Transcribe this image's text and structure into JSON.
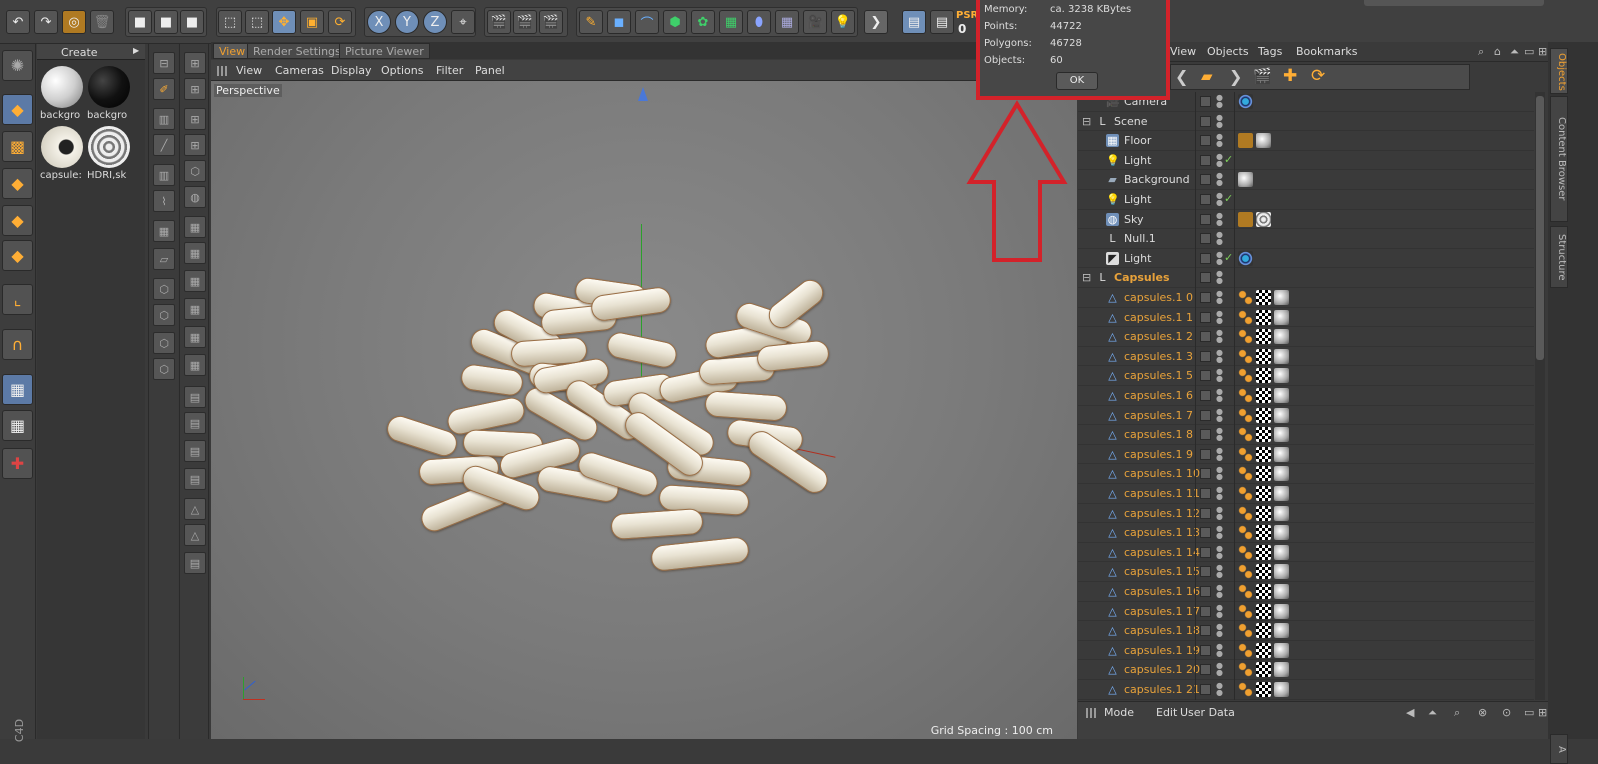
{
  "toolbar": {
    "axis_x": "X",
    "axis_y": "Y",
    "axis_z": "Z",
    "psr_label": "PSR",
    "psr_value": "0"
  },
  "materials": {
    "create_label": "Create",
    "items": [
      {
        "label": "backgro",
        "color": "#e8e8e8"
      },
      {
        "label": "backgro",
        "color": "#111111"
      },
      {
        "label": "capsule:",
        "color": "#d8d4c8"
      },
      {
        "label": "HDRI,sk",
        "color": "#a0a0a0"
      }
    ]
  },
  "viewport": {
    "tabs": [
      {
        "label": "View",
        "active": true
      },
      {
        "label": "Render Settings",
        "active": false
      },
      {
        "label": "Picture Viewer",
        "active": false
      }
    ],
    "menu": [
      "View",
      "Cameras",
      "Display",
      "Options",
      "Filter",
      "Panel"
    ],
    "camera_label": "Perspective",
    "grid_spacing": "Grid Spacing : 100 cm"
  },
  "info_dialog": {
    "rows": [
      {
        "label": "Memory:",
        "value": "ca. 3238 KBytes"
      },
      {
        "label": "Points:",
        "value": "44722"
      },
      {
        "label": "Polygons:",
        "value": "46728"
      },
      {
        "label": "Objects:",
        "value": "60"
      }
    ],
    "ok_label": "OK"
  },
  "object_manager": {
    "menu": [
      "View",
      "Objects",
      "Tags",
      "Bookmarks"
    ],
    "rows": [
      {
        "name": "Camera",
        "depth": 1,
        "kind": "camera",
        "highlight": false,
        "tick": false,
        "tags": [
          "target"
        ]
      },
      {
        "name": "Scene",
        "depth": 0,
        "kind": "null",
        "highlight": false,
        "tick": false,
        "tags": []
      },
      {
        "name": "Floor",
        "depth": 1,
        "kind": "floor",
        "highlight": false,
        "tick": false,
        "tags": [
          "render",
          "sphere"
        ]
      },
      {
        "name": "Light",
        "depth": 1,
        "kind": "light",
        "highlight": false,
        "tick": true,
        "tags": []
      },
      {
        "name": "Background",
        "depth": 1,
        "kind": "background",
        "highlight": false,
        "tick": false,
        "tags": [
          "sphere"
        ]
      },
      {
        "name": "Light",
        "depth": 1,
        "kind": "light",
        "highlight": false,
        "tick": true,
        "tags": []
      },
      {
        "name": "Sky",
        "depth": 1,
        "kind": "sky",
        "highlight": false,
        "tick": false,
        "tags": [
          "render",
          "hdri"
        ]
      },
      {
        "name": "Null.1",
        "depth": 1,
        "kind": "null",
        "highlight": false,
        "tick": false,
        "tags": []
      },
      {
        "name": "Light",
        "depth": 1,
        "kind": "spot",
        "highlight": false,
        "tick": true,
        "tags": [
          "target"
        ]
      },
      {
        "name": "Capsules",
        "depth": 0,
        "kind": "null",
        "highlight": true,
        "tick": false,
        "tags": []
      },
      {
        "name": "capsules.1 0",
        "depth": 1,
        "kind": "mesh",
        "highlight": true,
        "tick": false,
        "tags": [
          "phong",
          "checker",
          "sphere"
        ]
      },
      {
        "name": "capsules.1 1",
        "depth": 1,
        "kind": "mesh",
        "highlight": true,
        "tick": false,
        "tags": [
          "phong",
          "checker",
          "sphere"
        ]
      },
      {
        "name": "capsules.1 2",
        "depth": 1,
        "kind": "mesh",
        "highlight": true,
        "tick": false,
        "tags": [
          "phong",
          "checker",
          "sphere"
        ]
      },
      {
        "name": "capsules.1 3",
        "depth": 1,
        "kind": "mesh",
        "highlight": true,
        "tick": false,
        "tags": [
          "phong",
          "checker",
          "sphere"
        ]
      },
      {
        "name": "capsules.1 5",
        "depth": 1,
        "kind": "mesh",
        "highlight": true,
        "tick": false,
        "tags": [
          "phong",
          "checker",
          "sphere"
        ]
      },
      {
        "name": "capsules.1 6",
        "depth": 1,
        "kind": "mesh",
        "highlight": true,
        "tick": false,
        "tags": [
          "phong",
          "checker",
          "sphere"
        ]
      },
      {
        "name": "capsules.1 7",
        "depth": 1,
        "kind": "mesh",
        "highlight": true,
        "tick": false,
        "tags": [
          "phong",
          "checker",
          "sphere"
        ]
      },
      {
        "name": "capsules.1 8",
        "depth": 1,
        "kind": "mesh",
        "highlight": true,
        "tick": false,
        "tags": [
          "phong",
          "checker",
          "sphere"
        ]
      },
      {
        "name": "capsules.1 9",
        "depth": 1,
        "kind": "mesh",
        "highlight": true,
        "tick": false,
        "tags": [
          "phong",
          "checker",
          "sphere"
        ]
      },
      {
        "name": "capsules.1 10",
        "depth": 1,
        "kind": "mesh",
        "highlight": true,
        "tick": false,
        "tags": [
          "phong",
          "checker",
          "sphere"
        ]
      },
      {
        "name": "capsules.1 11",
        "depth": 1,
        "kind": "mesh",
        "highlight": true,
        "tick": false,
        "tags": [
          "phong",
          "checker",
          "sphere"
        ]
      },
      {
        "name": "capsules.1 12",
        "depth": 1,
        "kind": "mesh",
        "highlight": true,
        "tick": false,
        "tags": [
          "phong",
          "checker",
          "sphere"
        ]
      },
      {
        "name": "capsules.1 13",
        "depth": 1,
        "kind": "mesh",
        "highlight": true,
        "tick": false,
        "tags": [
          "phong",
          "checker",
          "sphere"
        ]
      },
      {
        "name": "capsules.1 14",
        "depth": 1,
        "kind": "mesh",
        "highlight": true,
        "tick": false,
        "tags": [
          "phong",
          "checker",
          "sphere"
        ]
      },
      {
        "name": "capsules.1 15",
        "depth": 1,
        "kind": "mesh",
        "highlight": true,
        "tick": false,
        "tags": [
          "phong",
          "checker",
          "sphere"
        ]
      },
      {
        "name": "capsules.1 16",
        "depth": 1,
        "kind": "mesh",
        "highlight": true,
        "tick": false,
        "tags": [
          "phong",
          "checker",
          "sphere"
        ]
      },
      {
        "name": "capsules.1 17",
        "depth": 1,
        "kind": "mesh",
        "highlight": true,
        "tick": false,
        "tags": [
          "phong",
          "checker",
          "sphere"
        ]
      },
      {
        "name": "capsules.1 18",
        "depth": 1,
        "kind": "mesh",
        "highlight": true,
        "tick": false,
        "tags": [
          "phong",
          "checker",
          "sphere"
        ]
      },
      {
        "name": "capsules.1 19",
        "depth": 1,
        "kind": "mesh",
        "highlight": true,
        "tick": false,
        "tags": [
          "phong",
          "checker",
          "sphere"
        ]
      },
      {
        "name": "capsules.1 20",
        "depth": 1,
        "kind": "mesh",
        "highlight": true,
        "tick": false,
        "tags": [
          "phong",
          "checker",
          "sphere"
        ]
      },
      {
        "name": "capsules.1 21",
        "depth": 1,
        "kind": "mesh",
        "highlight": true,
        "tick": false,
        "tags": [
          "phong",
          "checker",
          "sphere"
        ]
      }
    ],
    "bottom_menu": [
      "Mode",
      "Edit",
      "User Data"
    ]
  },
  "side_tabs": [
    {
      "label": "Objects",
      "active": true
    },
    {
      "label": "Content Browser",
      "active": false
    },
    {
      "label": "Structure",
      "active": false
    }
  ],
  "colors": {
    "accent": "#f0a030",
    "annotation": "#d3222a",
    "highlight_text": "#e8a23a"
  },
  "corner_label": "C4D"
}
